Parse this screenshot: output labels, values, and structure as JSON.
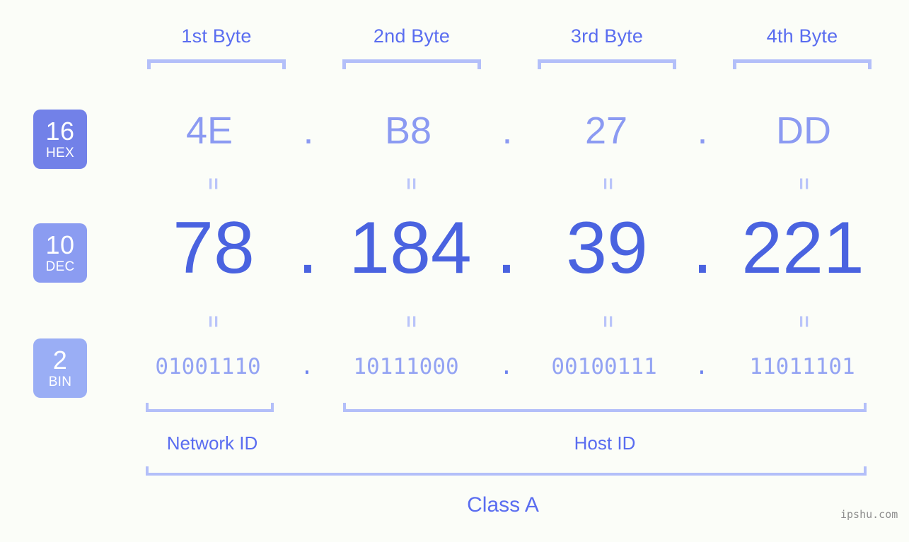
{
  "meta": {
    "background_color": "#fbfdf8",
    "watermark": "ipshu.com"
  },
  "colors": {
    "hex_text": "#8b9af2",
    "dec_text": "#4a63e0",
    "bin_text": "#93a3f3",
    "bracket": "#b3bff9",
    "label": "#5a6df0",
    "badge_hex": "#7281e8",
    "badge_dec": "#8b9cf1",
    "badge_bin": "#9aaef5"
  },
  "byte_headers": [
    {
      "label": "1st Byte"
    },
    {
      "label": "2nd Byte"
    },
    {
      "label": "3rd Byte"
    },
    {
      "label": "4th Byte"
    }
  ],
  "bases": [
    {
      "number": "16",
      "name": "HEX"
    },
    {
      "number": "10",
      "name": "DEC"
    },
    {
      "number": "2",
      "name": "BIN"
    }
  ],
  "separator": ".",
  "equals": "=",
  "rows": {
    "hex": {
      "values": [
        "4E",
        "B8",
        "27",
        "DD"
      ]
    },
    "dec": {
      "values": [
        "78",
        "184",
        "39",
        "221"
      ]
    },
    "bin": {
      "values": [
        "01001110",
        "10111000",
        "00100111",
        "11011101"
      ]
    }
  },
  "segments": {
    "network_id": "Network ID",
    "host_id": "Host ID",
    "class": "Class A"
  },
  "ip_address": "78.184.39.221"
}
